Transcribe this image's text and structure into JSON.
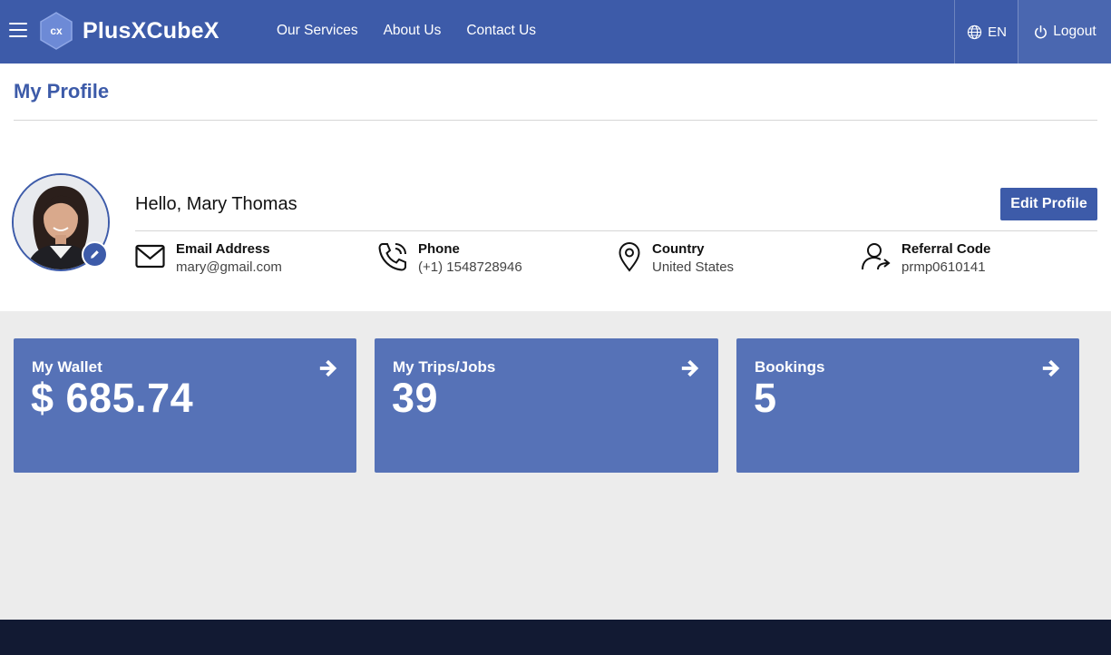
{
  "header": {
    "brand": "PlusXCubeX",
    "logo_text": "cx",
    "nav": [
      "Our Services",
      "About Us",
      "Contact Us"
    ],
    "language": "EN",
    "logout": "Logout"
  },
  "profile": {
    "page_title": "My Profile",
    "greeting": "Hello, Mary Thomas",
    "edit_button": "Edit Profile",
    "fields": [
      {
        "label": "Email Address",
        "value": "mary@gmail.com",
        "icon": "envelope-icon"
      },
      {
        "label": "Phone",
        "value": "(+1) 1548728946",
        "icon": "phone-icon"
      },
      {
        "label": "Country",
        "value": "United States",
        "icon": "map-pin-icon"
      },
      {
        "label": "Referral Code",
        "value": "prmp0610141",
        "icon": "user-share-icon"
      }
    ]
  },
  "cards": [
    {
      "title": "My Wallet",
      "value": "$ 685.74",
      "icon": "arrow-right-icon"
    },
    {
      "title": "My Trips/Jobs",
      "value": "39",
      "icon": "arrow-right-icon"
    },
    {
      "title": "Bookings",
      "value": "5",
      "icon": "arrow-right-icon"
    }
  ],
  "colors": {
    "primary": "#3d5ba9",
    "card": "#5672b7",
    "footer": "#121a33",
    "page_bg": "#ececec"
  }
}
